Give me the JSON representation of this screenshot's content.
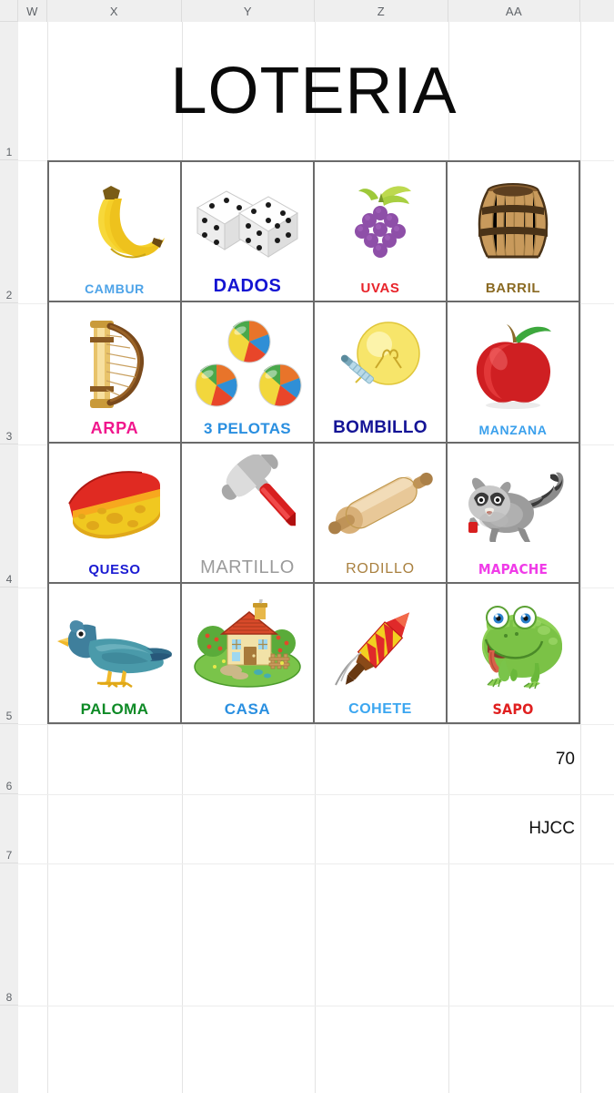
{
  "app": {
    "type": "spreadsheet",
    "title": "LOTERIA"
  },
  "grid": {
    "column_headers": [
      "W",
      "X",
      "Y",
      "Z",
      "AA"
    ],
    "row_headers": [
      "1",
      "2",
      "3",
      "4",
      "5",
      "6",
      "7",
      "8"
    ]
  },
  "sheet_title": "LOTERIA",
  "cards": [
    {
      "label": "CAMBUR",
      "icon": "bananas-icon",
      "label_color": "#4da3e8",
      "style": "lbl-cambur"
    },
    {
      "label": "DADOS",
      "icon": "dice-icon",
      "label_color": "#1414d2",
      "style": "lbl-dados"
    },
    {
      "label": "UVAS",
      "icon": "grapes-icon",
      "label_color": "#e8232a",
      "style": "lbl-uvas"
    },
    {
      "label": "BARRIL",
      "icon": "barrel-icon",
      "label_color": "#8a6a23",
      "style": "lbl-barril"
    },
    {
      "label": "ARPA",
      "icon": "harp-icon",
      "label_color": "#f0168c",
      "style": "lbl-arpa"
    },
    {
      "label": "3 PELOTAS",
      "icon": "beach-balls-icon",
      "label_color": "#2a8fe0",
      "style": "lbl-pelotas"
    },
    {
      "label": "BOMBILLO",
      "icon": "lightbulb-icon",
      "label_color": "#141496",
      "style": "lbl-bombillo"
    },
    {
      "label": "MANZANA",
      "icon": "apple-icon",
      "label_color": "#3aa0ec",
      "style": "lbl-manzana"
    },
    {
      "label": "QUESO",
      "icon": "cheese-icon",
      "label_color": "#1a1ad2",
      "style": "lbl-queso"
    },
    {
      "label": "MARTILLO",
      "icon": "hammer-icon",
      "label_color": "#9b9b9b",
      "style": "lbl-martillo"
    },
    {
      "label": "RODILLO",
      "icon": "rolling-pin-icon",
      "label_color": "#a9803f",
      "style": "lbl-rodillo"
    },
    {
      "label": "MAPACHE",
      "icon": "raccoon-icon",
      "label_color": "#f03ce8",
      "style": "lbl-mapache"
    },
    {
      "label": "PALOMA",
      "icon": "pigeon-icon",
      "label_color": "#0e8a26",
      "style": "lbl-paloma"
    },
    {
      "label": "CASA",
      "icon": "house-icon",
      "label_color": "#2a8fe0",
      "style": "lbl-casa"
    },
    {
      "label": "COHETE",
      "icon": "firework-rocket-icon",
      "label_color": "#3ba6f0",
      "style": "lbl-cohete"
    },
    {
      "label": "SAPO",
      "icon": "frog-icon",
      "label_color": "#e02020",
      "style": "lbl-sapo"
    }
  ],
  "data_cells": [
    {
      "name": "cell-row6-value",
      "value": "70"
    },
    {
      "name": "cell-row7-value",
      "value": "HJCC"
    }
  ]
}
